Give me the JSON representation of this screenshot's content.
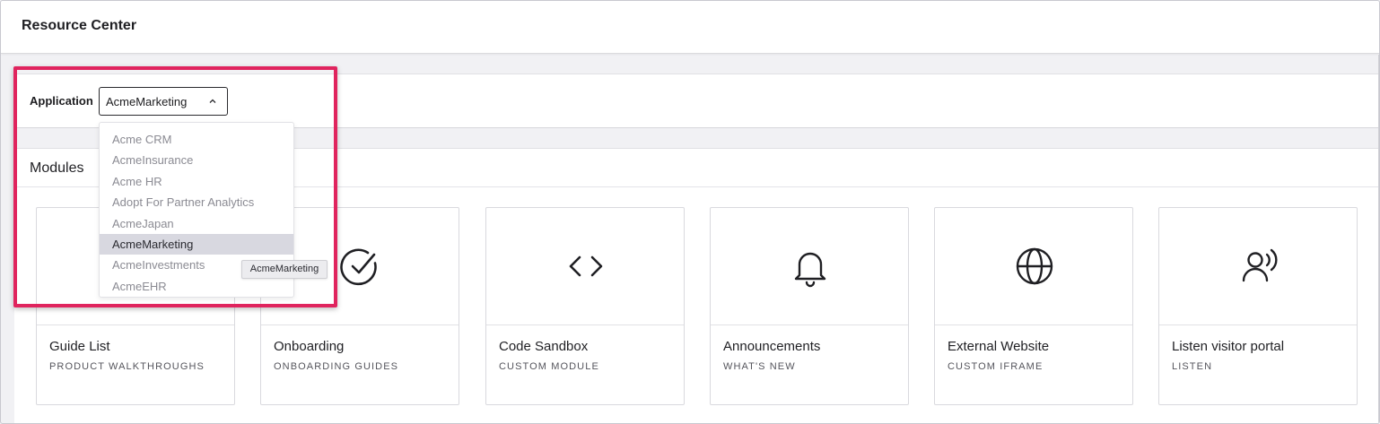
{
  "header": {
    "title": "Resource Center"
  },
  "application": {
    "label": "Application",
    "selected": "AcmeMarketing",
    "options": [
      "Acme CRM",
      "AcmeInsurance",
      "Acme HR",
      "Adopt For Partner Analytics",
      "AcmeJapan",
      "AcmeMarketing",
      "AcmeInvestments",
      "AcmeEHR"
    ],
    "tooltip": "AcmeMarketing"
  },
  "modules": {
    "title": "Modules",
    "cards": [
      {
        "name": "Guide List",
        "sub": "PRODUCT WALKTHROUGHS",
        "icon": "list-icon"
      },
      {
        "name": "Onboarding",
        "sub": "ONBOARDING GUIDES",
        "icon": "check-circle-icon"
      },
      {
        "name": "Code Sandbox",
        "sub": "CUSTOM MODULE",
        "icon": "code-icon"
      },
      {
        "name": "Announcements",
        "sub": "WHAT'S NEW",
        "icon": "bell-icon"
      },
      {
        "name": "External Website",
        "sub": "CUSTOM IFRAME",
        "icon": "globe-icon"
      },
      {
        "name": "Listen visitor portal",
        "sub": "LISTEN",
        "icon": "person-voice-icon"
      }
    ]
  },
  "colors": {
    "highlight": "#e0245e",
    "selected_option_bg": "#d8d8e0"
  }
}
